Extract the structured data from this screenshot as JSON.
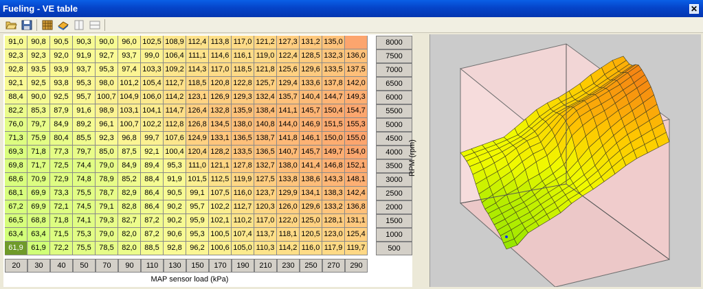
{
  "window": {
    "title": "Fueling - VE table",
    "close_glyph": "✕"
  },
  "toolbar": {
    "icons": [
      "open-folder-icon",
      "save-icon",
      "grid-view-icon",
      "surface-3d-icon",
      "split-vertical-icon",
      "split-horizontal-icon"
    ]
  },
  "table": {
    "rpm_label": "RPM (rpm)",
    "map_label": "MAP sensor load (kPa)",
    "map_kpa": [
      "20",
      "30",
      "40",
      "50",
      "70",
      "90",
      "110",
      "130",
      "150",
      "170",
      "190",
      "210",
      "230",
      "250",
      "270",
      "290"
    ],
    "rpm": [
      "8000",
      "7500",
      "7000",
      "6500",
      "6000",
      "5500",
      "5000",
      "4500",
      "4000",
      "3500",
      "3000",
      "2500",
      "2000",
      "1500",
      "1000",
      "500"
    ],
    "rows": [
      [
        "91,0",
        "90,8",
        "90,5",
        "90,3",
        "90,0",
        "96,0",
        "102,5",
        "108,9",
        "112,4",
        "113,8",
        "117,0",
        "121,2",
        "127,3",
        "131,2",
        "135,0"
      ],
      [
        "92,3",
        "92,3",
        "92,0",
        "91,9",
        "92,7",
        "93,7",
        "99,0",
        "106,4",
        "111,1",
        "114,6",
        "116,1",
        "119,0",
        "122,4",
        "128,5",
        "132,3",
        "136,0"
      ],
      [
        "92,8",
        "93,5",
        "93,9",
        "93,7",
        "95,3",
        "97,4",
        "103,3",
        "109,2",
        "114,3",
        "117,0",
        "118,5",
        "121,8",
        "125,6",
        "129,6",
        "133,5",
        "137,5"
      ],
      [
        "92,1",
        "92,5",
        "93,8",
        "95,3",
        "98,0",
        "101,2",
        "105,4",
        "112,7",
        "118,5",
        "120,8",
        "122,8",
        "125,7",
        "129,4",
        "133,6",
        "137,8",
        "142,0"
      ],
      [
        "88,4",
        "90,0",
        "92,5",
        "95,7",
        "100,7",
        "104,9",
        "106,0",
        "114,2",
        "123,1",
        "126,9",
        "129,3",
        "132,4",
        "135,7",
        "140,4",
        "144,7",
        "149,3"
      ],
      [
        "82,2",
        "85,3",
        "87,9",
        "91,6",
        "98,9",
        "103,1",
        "104,1",
        "114,7",
        "126,4",
        "132,8",
        "135,9",
        "138,4",
        "141,1",
        "145,7",
        "150,4",
        "154,7"
      ],
      [
        "76,0",
        "79,7",
        "84,9",
        "89,2",
        "96,1",
        "100,7",
        "102,2",
        "112,8",
        "126,8",
        "134,5",
        "138,0",
        "140,8",
        "144,0",
        "146,9",
        "151,5",
        "155,3"
      ],
      [
        "71,3",
        "75,9",
        "80,4",
        "85,5",
        "92,3",
        "96,8",
        "99,7",
        "107,6",
        "124,9",
        "133,1",
        "136,5",
        "138,7",
        "141,8",
        "146,1",
        "150,0",
        "155,0"
      ],
      [
        "69,3",
        "71,8",
        "77,3",
        "79,7",
        "85,0",
        "87,5",
        "92,1",
        "100,4",
        "120,4",
        "128,2",
        "133,5",
        "136,5",
        "140,7",
        "145,7",
        "149,7",
        "154,0"
      ],
      [
        "69,8",
        "71,7",
        "72,5",
        "74,4",
        "79,0",
        "84,9",
        "89,4",
        "95,3",
        "111,0",
        "121,1",
        "127,8",
        "132,7",
        "138,0",
        "141,4",
        "146,8",
        "152,1"
      ],
      [
        "68,6",
        "70,9",
        "72,9",
        "74,8",
        "78,9",
        "85,2",
        "88,4",
        "91,9",
        "101,5",
        "112,5",
        "119,9",
        "127,5",
        "133,8",
        "138,6",
        "143,3",
        "148,1"
      ],
      [
        "68,1",
        "69,9",
        "73,3",
        "75,5",
        "78,7",
        "82,9",
        "86,4",
        "90,5",
        "99,1",
        "107,5",
        "116,0",
        "123,7",
        "129,9",
        "134,1",
        "138,3",
        "142,4"
      ],
      [
        "67,2",
        "69,9",
        "72,1",
        "74,5",
        "79,1",
        "82,8",
        "86,4",
        "90,2",
        "95,7",
        "102,2",
        "112,7",
        "120,3",
        "126,0",
        "129,6",
        "133,2",
        "136,8"
      ],
      [
        "66,5",
        "68,8",
        "71,8",
        "74,1",
        "79,3",
        "82,7",
        "87,2",
        "90,2",
        "95,9",
        "102,1",
        "110,2",
        "117,0",
        "122,0",
        "125,0",
        "128,1",
        "131,1"
      ],
      [
        "63,4",
        "63,4",
        "71,5",
        "75,3",
        "79,0",
        "82,0",
        "87,2",
        "90,6",
        "95,3",
        "100,5",
        "107,4",
        "113,7",
        "118,1",
        "120,5",
        "123,0",
        "125,4"
      ],
      [
        "61,9",
        "61,9",
        "72,2",
        "75,5",
        "78,5",
        "82,0",
        "88,5",
        "92,8",
        "96,2",
        "100,6",
        "105,0",
        "110,3",
        "114,2",
        "116,0",
        "117,9",
        "119,7"
      ]
    ]
  }
}
